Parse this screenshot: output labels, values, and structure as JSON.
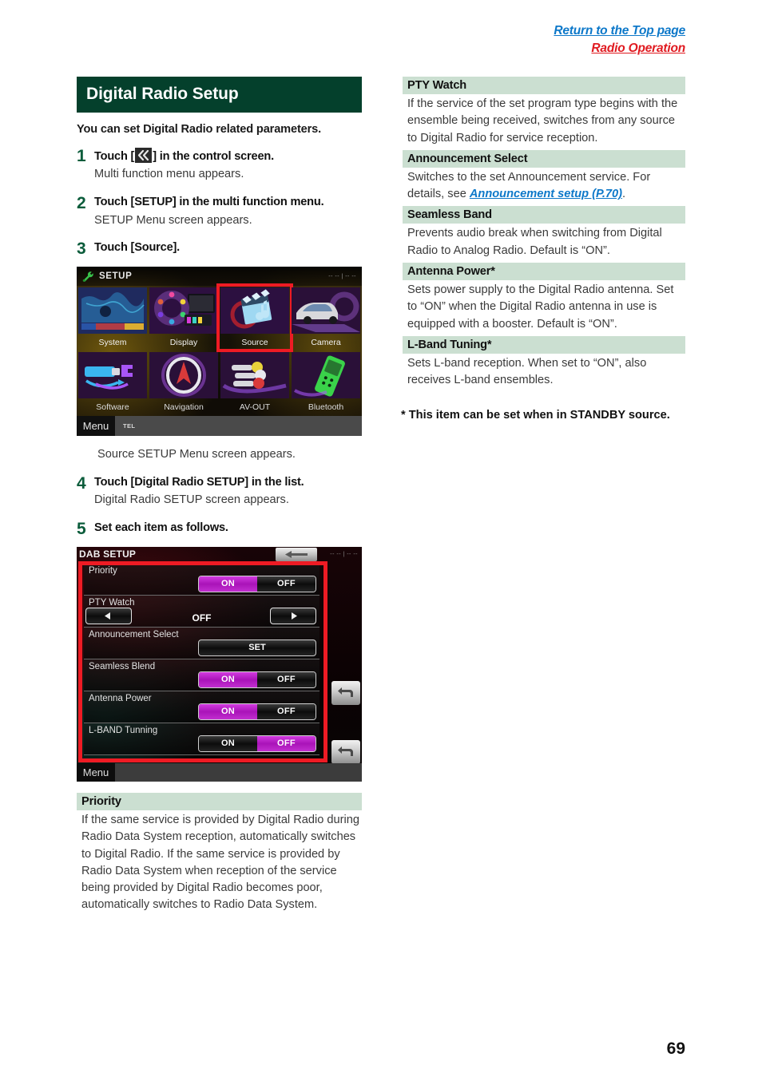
{
  "top_links": {
    "return_top": "Return to the Top page",
    "section": "Radio Operation"
  },
  "page_number": "69",
  "left": {
    "title": "Digital Radio Setup",
    "intro": "You can set Digital Radio related parameters.",
    "steps": [
      {
        "num": "1",
        "title_before": "Touch  [",
        "icon": "double-chevron-left-icon",
        "title_after": "] in the control screen.",
        "sub": "Multi function menu appears."
      },
      {
        "num": "2",
        "title": "Touch [SETUP] in the multi function menu.",
        "sub": "SETUP Menu screen appears."
      },
      {
        "num": "3",
        "title": "Touch [Source].",
        "sub": "Source SETUP Menu screen appears."
      },
      {
        "num": "4",
        "title": "Touch [Digital Radio SETUP] in the list.",
        "sub": "Digital Radio SETUP screen appears."
      },
      {
        "num": "5",
        "title": "Set each item as follows.",
        "sub": ""
      }
    ],
    "setup_screen": {
      "header_title": "SETUP",
      "clock": "-- -- | -- --",
      "tiles": [
        {
          "label": "System",
          "highlighted": false
        },
        {
          "label": "Display",
          "highlighted": false
        },
        {
          "label": "Source",
          "highlighted": true
        },
        {
          "label": "Camera",
          "highlighted": false
        },
        {
          "label": "Software",
          "highlighted": false
        },
        {
          "label": "Navigation",
          "highlighted": false
        },
        {
          "label": "AV-OUT",
          "highlighted": false
        },
        {
          "label": "Bluetooth",
          "highlighted": false
        }
      ],
      "menu_button": "Menu",
      "tel_button": "TEL"
    },
    "dab_screen": {
      "header_title": "DAB SETUP",
      "clock": "-- -- | -- --",
      "rows": [
        {
          "label": "Priority",
          "control": "toggle",
          "options": [
            "ON",
            "OFF"
          ],
          "selected": "ON"
        },
        {
          "label": "PTY Watch",
          "control": "stepper",
          "value": "OFF"
        },
        {
          "label": "Announcement Select",
          "control": "button",
          "button_label": "SET"
        },
        {
          "label": "Seamless Blend",
          "control": "toggle",
          "options": [
            "ON",
            "OFF"
          ],
          "selected": "ON"
        },
        {
          "label": "Antenna Power",
          "control": "toggle",
          "options": [
            "ON",
            "OFF"
          ],
          "selected": "ON"
        },
        {
          "label": "L-BAND Tunning",
          "control": "toggle",
          "options": [
            "ON",
            "OFF"
          ],
          "selected": "OFF"
        }
      ],
      "menu_button": "Menu"
    },
    "priority_def": {
      "head": "Priority",
      "body": "If the same service is provided by Digital Radio during Radio Data System reception, automatically switches to Digital Radio. If the same service is provided by Radio Data System when reception of the service being provided by Digital Radio becomes poor, automatically switches to Radio Data System."
    }
  },
  "right": {
    "definitions": [
      {
        "head": "PTY Watch",
        "body": "If the service of the set program type begins with the ensemble being received, switches from any source to Digital Radio for service reception.",
        "link": null,
        "body_tail": null
      },
      {
        "head": "Announcement Select",
        "body": "Switches to the set Announcement service. For details, see ",
        "link": "Announcement setup (P.70)",
        "body_tail": "."
      },
      {
        "head": "Seamless Band",
        "body": "Prevents audio break when switching from Digital Radio to Analog Radio. Default is “ON”.",
        "link": null,
        "body_tail": null
      },
      {
        "head": "Antenna Power*",
        "body": "Sets power supply to the Digital Radio antenna. Set to “ON” when the Digital Radio antenna in use is equipped with a booster. Default is “ON”.",
        "link": null,
        "body_tail": null
      },
      {
        "head": "L-Band Tuning*",
        "body": "Sets L-band reception. When set to “ON”, also receives L-band ensembles.",
        "link": null,
        "body_tail": null
      }
    ],
    "footnote": "* This item can be set when in STANDBY source."
  },
  "colors": {
    "title_banner": "#04402c",
    "def_header": "#cbdfd1",
    "step_number": "#0b5c3b",
    "link_blue": "#0d78c9",
    "link_red": "#e01a20",
    "highlight_red": "#ee1b24",
    "toggle_on": "#a913b8"
  }
}
